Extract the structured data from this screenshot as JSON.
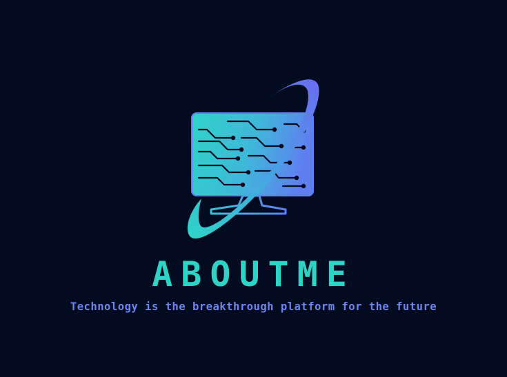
{
  "logo": {
    "icon": "computer-monitor-circuit-icon",
    "brand_name": "ABOUTME",
    "tagline": "Technology is the breakthrough platform for the future"
  },
  "colors": {
    "background": "#020b1f",
    "teal": "#2fd3c6",
    "blue": "#5f7ff0",
    "tagline": "#6b86f3"
  }
}
